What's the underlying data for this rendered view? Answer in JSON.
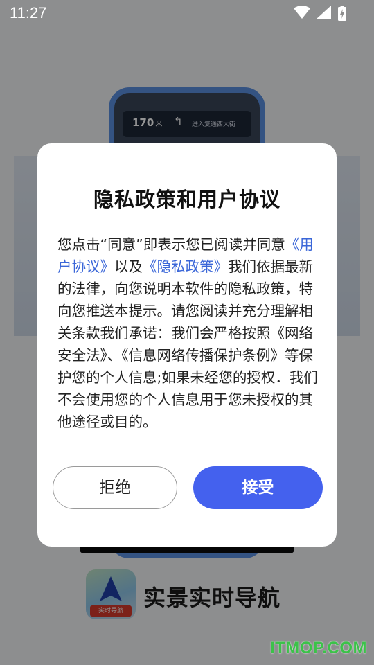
{
  "status_bar": {
    "time": "11:27",
    "icons": [
      "wifi-icon",
      "cellular-signal-icon",
      "battery-charging-icon"
    ]
  },
  "background": {
    "nav_preview": {
      "distance": "170",
      "unit": "米",
      "turn_symbol": "↰",
      "road": "进入复通西大街"
    },
    "app_badge": "实时导航",
    "app_name": "实景实时导航"
  },
  "dialog": {
    "title": "隐私政策和用户协议",
    "body": {
      "intro": "您点击“同意”即表示您已阅读并同意",
      "user_agreement_link": "《用户协议》",
      "and": "以及",
      "privacy_policy_link": "《隐私政策》",
      "rest": "我们依据最新的法律，向您说明本软件的隐私政策，特向您推送本提示。请您阅读并充分理解相关条款我们承诺：我们会严格按照《网络安全法》、《信息网络传播保护条例》等保护您的个人信息;如果未经您的授权．我们不会使用您的个人信息用于您未授权的其他途径或目的。"
    },
    "reject_label": "拒绝",
    "accept_label": "接受"
  },
  "watermark": "ITMOP.COM",
  "colors": {
    "accent": "#4461ee",
    "link": "#3a66d8",
    "watermark": "#3cc24a"
  }
}
